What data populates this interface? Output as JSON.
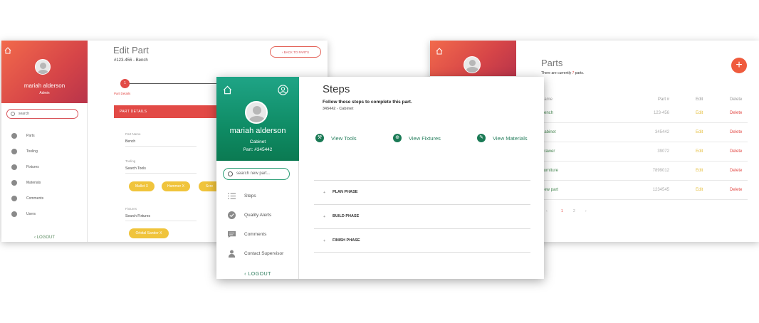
{
  "left_window": {
    "user": {
      "name": "mariah alderson",
      "role": "Admin"
    },
    "search_placeholder": "search",
    "nav": [
      {
        "label": "Parts",
        "icon": "parts-icon"
      },
      {
        "label": "Tooling",
        "icon": "tooling-icon"
      },
      {
        "label": "Fixtures",
        "icon": "fixtures-icon"
      },
      {
        "label": "Materials",
        "icon": "materials-icon"
      },
      {
        "label": "Comments",
        "icon": "comments-icon"
      },
      {
        "label": "Users",
        "icon": "users-icon"
      }
    ],
    "logout": "LOGOUT",
    "title": "Edit Part",
    "subtitle": "#123-456 - Bench",
    "back_button": "BACK TO PARTS",
    "step_number": "1",
    "step_label": "Part Details",
    "section_bar": "PART DETAILS",
    "fields": {
      "part_name_label": "Part Name",
      "part_name_value": "Bench",
      "tooling_label": "Tooling",
      "tooling_placeholder": "Search Tools",
      "fixtures_label": "Fixtures",
      "fixtures_placeholder": "Search Fixtures"
    },
    "tool_chips": [
      "Mallet X",
      "Hammer X",
      "Scre"
    ],
    "fixture_chips": [
      "Orbital Sander X"
    ],
    "accent": "#e24a46"
  },
  "right_window": {
    "title": "Parts",
    "subtitle_pre": "There are currently ",
    "subtitle_count": "7",
    "subtitle_post": " parts.",
    "add_button": "+",
    "columns": {
      "name": "Name",
      "part": "Part #",
      "edit": "Edit",
      "delete": "Delete"
    },
    "rows": [
      {
        "name": "Bench",
        "part": "123-456",
        "edit": "Edit",
        "delete": "Delete"
      },
      {
        "name": "Cabinet",
        "part": "345442",
        "edit": "Edit",
        "delete": "Delete"
      },
      {
        "name": "Drawer",
        "part": "39072",
        "edit": "Edit",
        "delete": "Delete"
      },
      {
        "name": "Furniture",
        "part": "7899012",
        "edit": "Edit",
        "delete": "Delete"
      },
      {
        "name": "New part",
        "part": "1234545",
        "edit": "Edit",
        "delete": "Delete"
      }
    ],
    "pagination": [
      "‹",
      "1",
      "2",
      "›"
    ]
  },
  "center_window": {
    "user": {
      "name": "mariah alderson",
      "line1": "Cabinet",
      "line2": "Part: #345442"
    },
    "search_placeholder": "search new part...",
    "nav": [
      {
        "label": "Steps",
        "icon": "list-icon"
      },
      {
        "label": "Quality Alerts",
        "icon": "check-circle-icon"
      },
      {
        "label": "Comments",
        "icon": "comment-icon"
      },
      {
        "label": "Contact Supervisor",
        "icon": "supervisor-icon"
      }
    ],
    "logout": "LOGOUT",
    "title": "Steps",
    "instruction": "Follow these steps to complete this part.",
    "part_ref": "345442 - Cabinet",
    "tool_links": [
      {
        "label": "View Tools",
        "icon": "tools-icon"
      },
      {
        "label": "View Fixtures",
        "icon": "fixtures-icon"
      },
      {
        "label": "View Materials",
        "icon": "materials-icon"
      }
    ],
    "phases": [
      "PLAN PHASE",
      "BUILD PHASE",
      "FINISH PHASE"
    ],
    "phase_marker": "+",
    "accent": "#0f8c65"
  }
}
